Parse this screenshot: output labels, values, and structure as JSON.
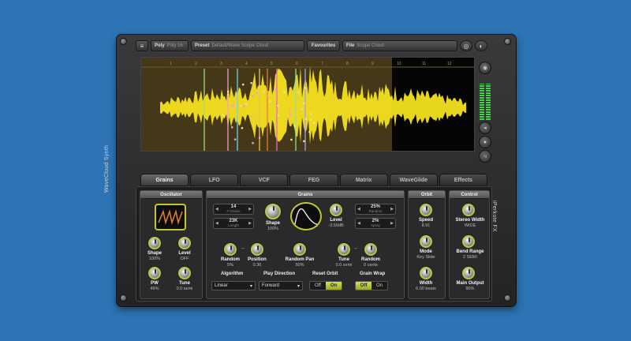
{
  "side_labels": {
    "left": "WaveCloud Synth",
    "right": "iPerkute FX"
  },
  "toolbar": {
    "menu_icon": "≡",
    "poly_label": "Poly",
    "poly_value": "Poly 16",
    "preset_label": "Preset",
    "preset_value": "Default/Wave Scope Cloud",
    "favorites": "Favourites",
    "file_label": "File",
    "file_value": "Scope Cloud",
    "icon_a": "◎",
    "icon_b": "◐"
  },
  "display": {
    "ruler_ticks": [
      "1",
      "2",
      "3",
      "4",
      "5",
      "6",
      "7",
      "8",
      "9",
      "10",
      "11",
      "12"
    ],
    "waveform_color": "#f4e020",
    "selection_color": "#5b4a20"
  },
  "side_buttons": [
    "◉",
    "◂",
    "●",
    "◃"
  ],
  "tabs": [
    {
      "label": "Grains",
      "active": true
    },
    {
      "label": "LFO",
      "active": false
    },
    {
      "label": "VCF",
      "active": false
    },
    {
      "label": "FEG",
      "active": false
    },
    {
      "label": "Matrix",
      "active": false
    },
    {
      "label": "WaveGlide",
      "active": false
    },
    {
      "label": "Effects",
      "active": false
    }
  ],
  "oscillator": {
    "title": "Oscillator",
    "shape_label": "Shape",
    "shape_value": "100%",
    "level_label": "Level",
    "level_value": "OFF",
    "pw_label": "PW",
    "pw_value": "49%",
    "tune_label": "Tune",
    "tune_value": "0.0 semi"
  },
  "grains": {
    "title": "Grains",
    "spin1_value": "14",
    "spin1_sub": "# Grains",
    "spin2_value": "23K",
    "spin2_sub": "Length",
    "spin3_value": "25%",
    "spin3_sub": "Random",
    "spin4_value": "2%",
    "spin4_sub": "Spray",
    "shape_label": "Shape",
    "shape_value": "100%",
    "level_label": "Level",
    "level_value": "-3.50dB",
    "random_label": "Random",
    "random_value": "5%",
    "position_label": "Position",
    "position_value": "0.36",
    "randpan_label": "Random Pan",
    "randpan_value": "50%",
    "tune_label": "Tune",
    "tune_value": "0.0 semi",
    "random2_label": "Random",
    "random2_value": "0 cents",
    "algorithm_label": "Algorithm",
    "algorithm_value": "Linear",
    "playdir_label": "Play Direction",
    "playdir_value": "Forward",
    "reset_label": "Reset Orbit",
    "reset_off": "Off",
    "reset_on": "On",
    "wrap_label": "Grain Wrap",
    "wrap_off": "Off",
    "wrap_on": "On"
  },
  "orbit": {
    "title": "Orbit",
    "speed_label": "Speed",
    "speed_value": "8.91",
    "mode_label": "Mode",
    "mode_value": "Key Slide",
    "width_label": "Width",
    "width_value": "6.00 beats"
  },
  "control": {
    "title": "Control",
    "stereo_label": "Stereo Width",
    "stereo_value": "WIDE",
    "bend_label": "Bend Range",
    "bend_value": "2 SEMI",
    "main_label": "Main Output",
    "main_value": "90%"
  },
  "colors": {
    "knob_ring": "#b8c940",
    "switch_on": "#d7e04a"
  }
}
